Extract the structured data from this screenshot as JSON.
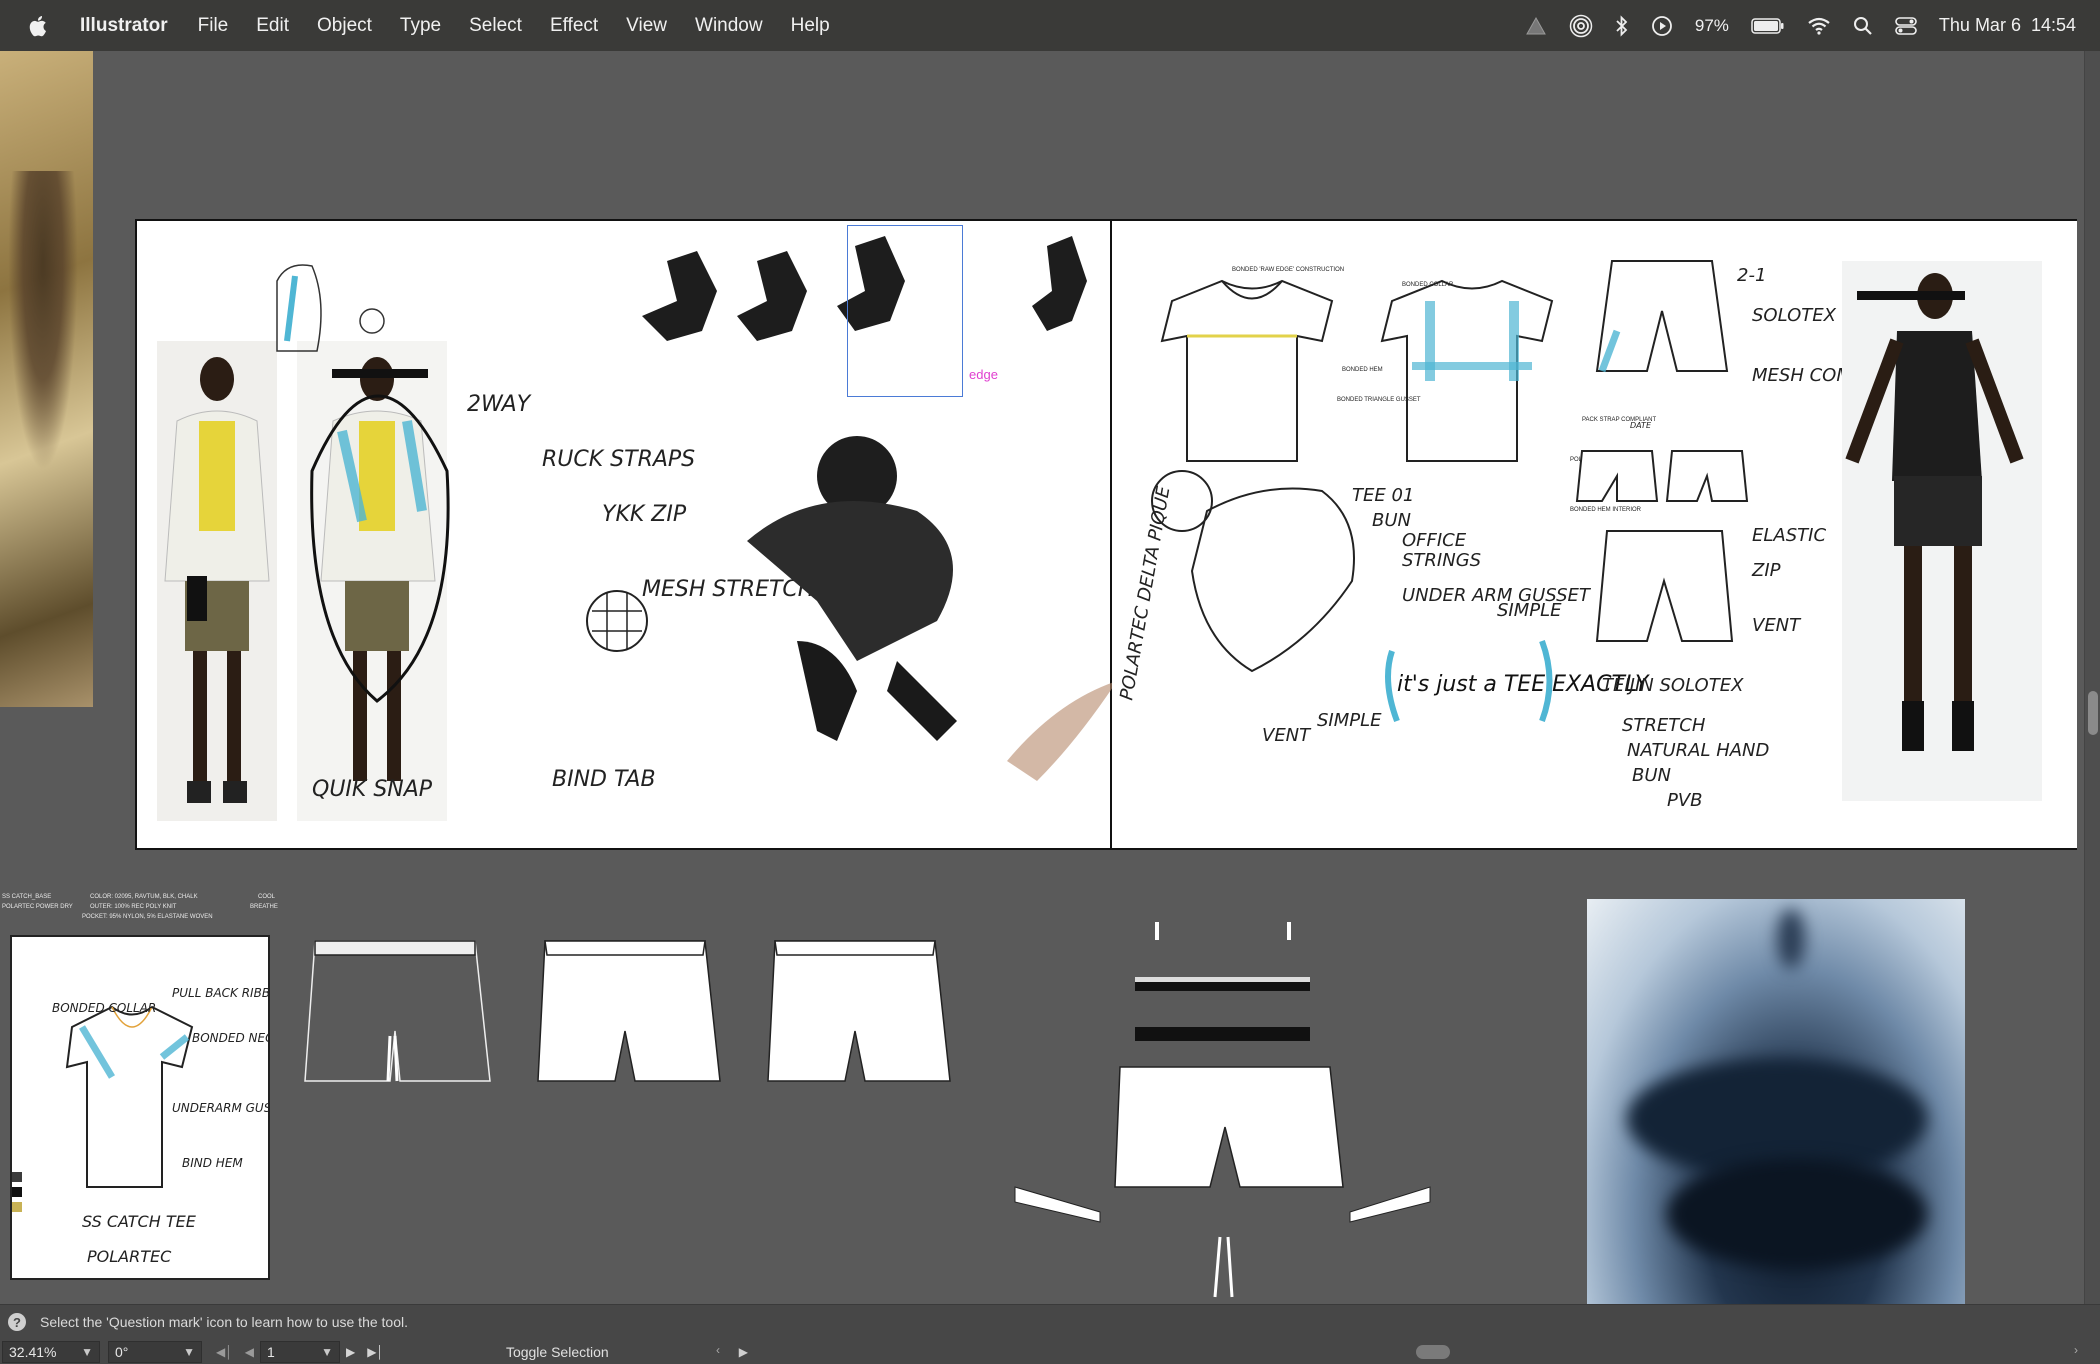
{
  "menubar": {
    "app_name": "Illustrator",
    "menus": [
      "File",
      "Edit",
      "Object",
      "Type",
      "Select",
      "Effect",
      "View",
      "Window",
      "Help"
    ],
    "battery": "97%",
    "datetime": "Thu Mar 6  14:54"
  },
  "canvas": {
    "selection_label": "edge",
    "sketch_notes_left": [
      "2WAY",
      "RUCK STRAPS",
      "YKK ZIP",
      "MESH STRETCH WOVEN",
      "QUIK SNAP",
      "BIND TAB"
    ],
    "sketch_notes_right": [
      "TEE 01",
      "BUN",
      "OFFICE",
      "STRINGS",
      "UNDER ARM GUSSET",
      "SIMPLE",
      "VENT",
      "SIMPLE",
      "POLARTEC DELTA PIQUE",
      "it's just a TEE EXACTLY"
    ],
    "sketch_notes_shorts": [
      "2-1",
      "SOLOTEX",
      "MESH COMPR",
      "ELASTIC",
      "ZIP",
      "VENT",
      "TEIJIN SOLOTEX",
      "STRETCH",
      "NATURAL HAND",
      "BUN",
      "PVB",
      "DATE"
    ],
    "bottom_card_header": [
      "SS CATCH_BASE",
      "COLOR: 02095, RAVTUM, BLK, CHALK",
      "POLARTEC POWER DRY",
      "OUTER: 100% REC POLY KNIT",
      "POCKET: 95% NYLON, 5% ELASTANE WOVEN",
      "COOL",
      "BREATHE"
    ],
    "bottom_card_notes": [
      "BONDED COLLAR",
      "PULL BACK RIBBON",
      "BONDED NECK SLEEVE",
      "UNDERARM GUSSET",
      "BIND HEM",
      "SS CATCH TEE",
      "POLARTEC"
    ],
    "tech_labels": [
      "BONDED 'RAW EDGE' CONSTRUCTION",
      "BONDED COLLAR",
      "BONDED HEM",
      "BONDED TRIANGLE GUSSET",
      "PACK STRAP COMPLIANT",
      "POLARTEC DELTA",
      "BONDED HEM INTERIOR"
    ]
  },
  "statusbar": {
    "hint": "Select the 'Question mark' icon to learn how to use the tool.",
    "zoom": "32.41%",
    "rotation": "0°",
    "artboard_number": "1",
    "toggle_label": "Toggle Selection"
  },
  "colors": {
    "menubar_bg": "#3a3a38",
    "canvas_bg": "#5a5a5a",
    "statusbar_bg": "#474747",
    "selection_blue": "#4b7bd6",
    "edge_magenta": "#e040d0",
    "sketch_cyan": "#4fb6d4",
    "sketch_yellow": "#e2d24a"
  },
  "icons": [
    "apple-icon",
    "control-center-icon",
    "search-icon",
    "wifi-icon",
    "battery-icon",
    "play-icon",
    "bluetooth-icon",
    "airdrop-icon",
    "vectorworks-icon",
    "question-mark-icon"
  ]
}
